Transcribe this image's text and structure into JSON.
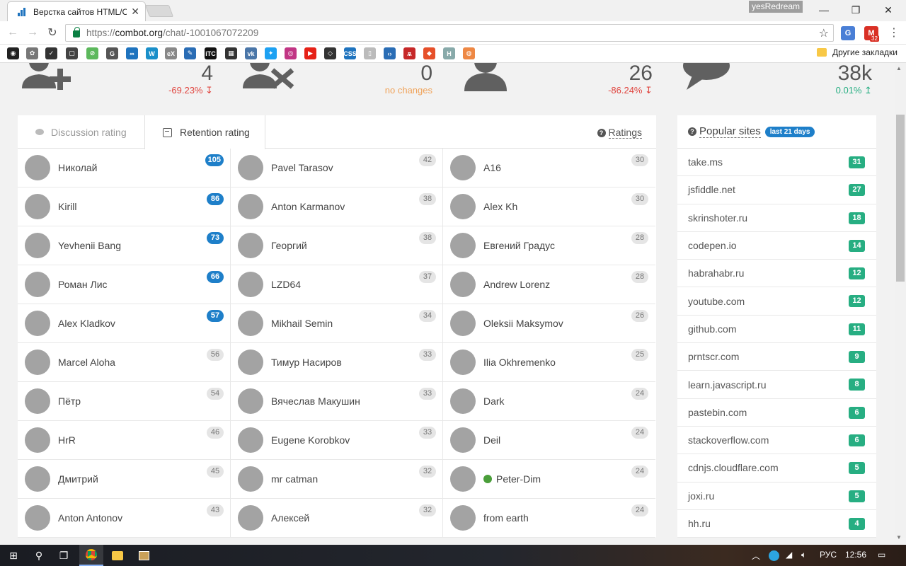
{
  "browser": {
    "tab_title": "Верстка сайтов HTML/C",
    "profile_name": "yesRedream",
    "url_prefix": "https://",
    "url_host": "combot.org",
    "url_path": "/chat/-1001067072209",
    "bookmarks_folder": "Другие закладки",
    "mail_badge": "32"
  },
  "stats": [
    {
      "value": "4",
      "delta": "-69.23% ↧",
      "trend": "down"
    },
    {
      "value": "0",
      "delta": "no changes",
      "trend": "none"
    },
    {
      "value": "26",
      "delta": "-86.24% ↧",
      "trend": "down"
    },
    {
      "value": "38k",
      "delta": "0.01% ↥",
      "trend": "up"
    }
  ],
  "tabs": {
    "discussion": "Discussion rating",
    "retention": "Retention rating",
    "ratings_link": "Ratings"
  },
  "columns": [
    [
      {
        "name": "Николай",
        "count": "105",
        "hl": true
      },
      {
        "name": "Kirill",
        "count": "86",
        "hl": true
      },
      {
        "name": "Yevhenii Bang",
        "count": "73",
        "hl": true
      },
      {
        "name": "Роман Лис",
        "count": "66",
        "hl": true
      },
      {
        "name": "Alex Kladkov",
        "count": "57",
        "hl": true
      },
      {
        "name": "Marcel Aloha",
        "count": "56",
        "hl": false
      },
      {
        "name": "Пётр",
        "count": "54",
        "hl": false
      },
      {
        "name": "HrR",
        "count": "46",
        "hl": false
      },
      {
        "name": "Дмитрий",
        "count": "45",
        "hl": false
      },
      {
        "name": "Anton Antonov",
        "count": "43",
        "hl": false
      }
    ],
    [
      {
        "name": "Pavel Tarasov",
        "count": "42",
        "hl": false
      },
      {
        "name": "Anton Karmanov",
        "count": "38",
        "hl": false
      },
      {
        "name": "Георгий",
        "count": "38",
        "hl": false
      },
      {
        "name": "LZD64",
        "count": "37",
        "hl": false
      },
      {
        "name": "Mikhail Semin",
        "count": "34",
        "hl": false
      },
      {
        "name": "Тимур Насиров",
        "count": "33",
        "hl": false
      },
      {
        "name": "Вячеслав Макушин",
        "count": "33",
        "hl": false
      },
      {
        "name": "Eugene Korobkov",
        "count": "33",
        "hl": false
      },
      {
        "name": "mr catman",
        "count": "32",
        "hl": false
      },
      {
        "name": "Алексей",
        "count": "32",
        "hl": false
      }
    ],
    [
      {
        "name": "A16",
        "count": "30",
        "hl": false
      },
      {
        "name": "Alex Kh",
        "count": "30",
        "hl": false
      },
      {
        "name": "Евгений Градус",
        "count": "28",
        "hl": false
      },
      {
        "name": "Andrew Lorenz",
        "count": "28",
        "hl": false
      },
      {
        "name": "Oleksii Maksymov",
        "count": "26",
        "hl": false
      },
      {
        "name": "Ilia Okhremenko",
        "count": "25",
        "hl": false
      },
      {
        "name": "Dark",
        "count": "24",
        "hl": false
      },
      {
        "name": "Deil",
        "count": "24",
        "hl": false
      },
      {
        "name": "Peter-Dim",
        "count": "24",
        "hl": false,
        "emoji": true
      },
      {
        "name": "from earth",
        "count": "24",
        "hl": false
      }
    ]
  ],
  "popular": {
    "title": "Popular sites",
    "badge": "last 21 days",
    "sites": [
      {
        "name": "take.ms",
        "count": "31"
      },
      {
        "name": "jsfiddle.net",
        "count": "27"
      },
      {
        "name": "skrinshoter.ru",
        "count": "18"
      },
      {
        "name": "codepen.io",
        "count": "14"
      },
      {
        "name": "habrahabr.ru",
        "count": "12"
      },
      {
        "name": "youtube.com",
        "count": "12"
      },
      {
        "name": "github.com",
        "count": "11"
      },
      {
        "name": "prntscr.com",
        "count": "9"
      },
      {
        "name": "learn.javascript.ru",
        "count": "8"
      },
      {
        "name": "pastebin.com",
        "count": "6"
      },
      {
        "name": "stackoverflow.com",
        "count": "6"
      },
      {
        "name": "cdnjs.cloudflare.com",
        "count": "5"
      },
      {
        "name": "joxi.ru",
        "count": "5"
      },
      {
        "name": "hh.ru",
        "count": "4"
      }
    ]
  },
  "taskbar": {
    "lang": "РУС",
    "time": "12:56"
  },
  "colors": {
    "accent_blue": "#1e7fc9",
    "site_green": "#27ae82",
    "delta_down": "#e0453f",
    "delta_none": "#f0a35a",
    "delta_up": "#27ae82"
  }
}
